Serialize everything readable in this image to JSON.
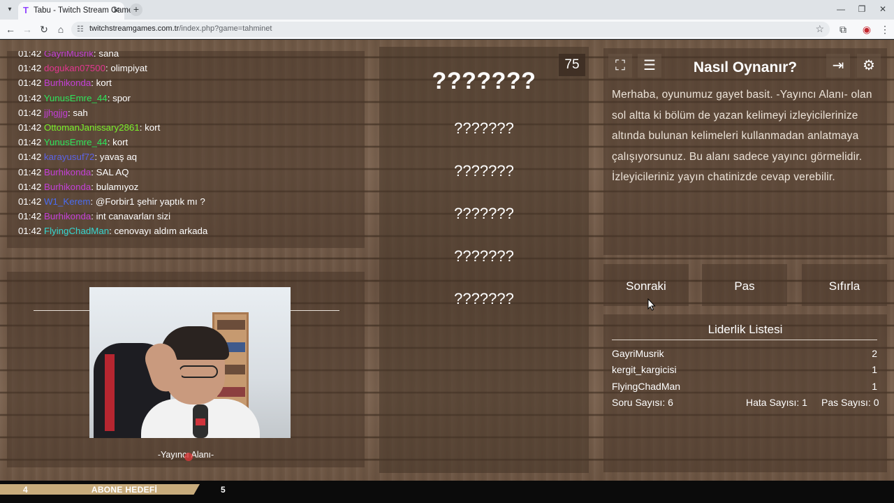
{
  "browser": {
    "tab_title": "Tabu - Twitch Stream Games",
    "tab_favicon": "T",
    "url_domain": "twitchstreamgames.com.tr",
    "url_path": "/index.php?game=tahminet"
  },
  "chat": {
    "lines": [
      {
        "time": "01:42",
        "user": "GayriMusrik",
        "msg": ": sana",
        "color": "#c23fd6"
      },
      {
        "time": "01:42",
        "user": "dogukan07500",
        "msg": ": olimpiyat",
        "color": "#e0368f"
      },
      {
        "time": "01:42",
        "user": "Burhikonda",
        "msg": ": kort",
        "color": "#c23fd6"
      },
      {
        "time": "01:42",
        "user": "YunusEmre_44",
        "msg": ": spor",
        "color": "#2ee35a"
      },
      {
        "time": "01:42",
        "user": "jjhgjjg",
        "msg": ": sah",
        "color": "#c23fd6"
      },
      {
        "time": "01:42",
        "user": "OttomanJanissary2861",
        "msg": ": kort",
        "color": "#79f02a"
      },
      {
        "time": "01:42",
        "user": "YunusEmre_44",
        "msg": ": kort",
        "color": "#2ee35a"
      },
      {
        "time": "01:42",
        "user": "karayusuf72",
        "msg": ": yavaş aq",
        "color": "#5b62e6"
      },
      {
        "time": "01:42",
        "user": "Burhikonda",
        "msg": ": SAL AQ",
        "color": "#c23fd6"
      },
      {
        "time": "01:42",
        "user": "Burhikonda",
        "msg": ": bulamıyoz",
        "color": "#c23fd6"
      },
      {
        "time": "01:42",
        "user": "W1_Kerem",
        "msg": ": @Forbir1 şehir yaptık mı ?",
        "color": "#4a6cf0"
      },
      {
        "time": "01:42",
        "user": "Burhikonda",
        "msg": ": int canavarları sizi",
        "color": "#c23fd6"
      },
      {
        "time": "01:42",
        "user": "FlyingChadMan",
        "msg": ": cenovayı aldım arkada",
        "color": "#35d6d0"
      }
    ]
  },
  "streamer": {
    "label": "-Yayıncı Alanı-"
  },
  "game": {
    "timer": "75",
    "main_word": "???????",
    "taboo_words": [
      "???????",
      "???????",
      "???????",
      "???????",
      "???????"
    ]
  },
  "howto": {
    "title": "Nasıl Oynanır?",
    "body": "Merhaba, oyunumuz gayet basit. -Yayıncı Alanı- olan sol altta ki bölüm de yazan kelimeyi izleyicilerinize altında bulunan kelimeleri kullanmadan anlatmaya çalışıyorsunuz. Bu alanı sadece yayıncı görmelidir. İzleyicileriniz yayın chatinizde cevap verebilir."
  },
  "actions": {
    "next": "Sonraki",
    "pass": "Pas",
    "reset": "Sıfırla"
  },
  "leaderboard": {
    "title": "Liderlik Listesi",
    "rows": [
      {
        "name": "GayriMusrik",
        "score": "2"
      },
      {
        "name": "kergit_kargicisi",
        "score": "1"
      },
      {
        "name": "FlyingChadMan",
        "score": "1"
      }
    ],
    "question_count": "Soru Sayısı: 6",
    "error_count": "Hata Sayısı: 1",
    "pass_count": "Pas Sayısı: 0"
  },
  "goal": {
    "current": "4",
    "label": "ABONE HEDEFİ",
    "target": "5",
    "progress_fraction": 0.8
  },
  "icons": {
    "fullscreen": "fullscreen-icon",
    "notes": "notes-icon",
    "exit": "exit-icon",
    "settings": "gear-icon"
  }
}
